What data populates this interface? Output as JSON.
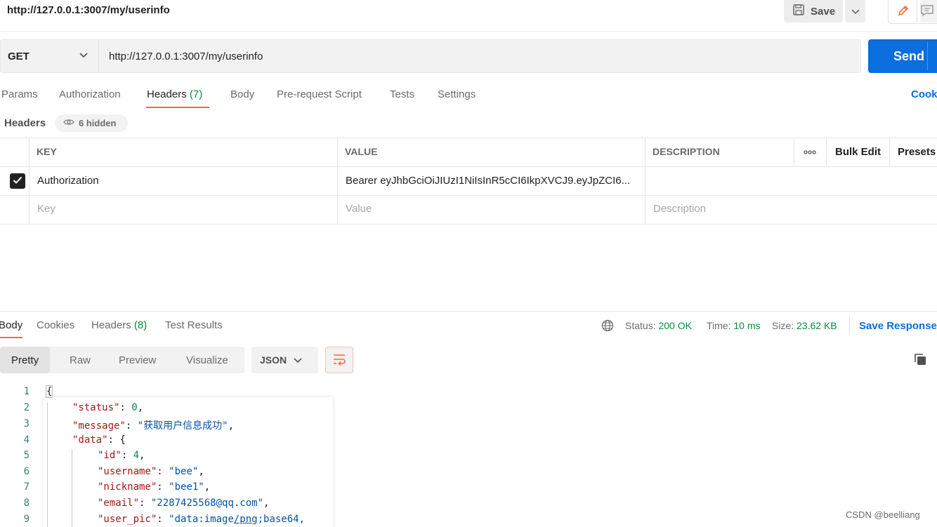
{
  "request": {
    "title": "http://127.0.0.1:3007/my/userinfo",
    "method": "GET",
    "url": "http://127.0.0.1:3007/my/userinfo",
    "save_label": "Save",
    "send_label": "Send"
  },
  "request_tabs": {
    "params": "Params",
    "authorization": "Authorization",
    "headers": "Headers",
    "headers_count": "(7)",
    "body": "Body",
    "prerequest": "Pre-request Script",
    "tests": "Tests",
    "settings": "Settings",
    "cookies": "Cook"
  },
  "headers_section": {
    "title": "Headers",
    "hidden_label": "6 hidden"
  },
  "headers_table": {
    "columns": {
      "key": "KEY",
      "value": "VALUE",
      "description": "DESCRIPTION",
      "bulk_edit": "Bulk Edit",
      "presets": "Presets"
    },
    "rows": [
      {
        "checked": true,
        "key": "Authorization",
        "value": "Bearer eyJhbGciOiJIUzI1NiIsInR5cCI6IkpXVCJ9.eyJpZCI6...",
        "description": ""
      }
    ],
    "placeholders": {
      "key": "Key",
      "value": "Value",
      "description": "Description"
    }
  },
  "response_tabs": {
    "body": "Body",
    "cookies": "Cookies",
    "headers": "Headers",
    "headers_count": "(8)",
    "test_results": "Test Results"
  },
  "response_status": {
    "status_label": "Status:",
    "status_value": "200 OK",
    "time_label": "Time:",
    "time_value": "10 ms",
    "size_label": "Size:",
    "size_value": "23.62 KB",
    "save_response": "Save Response"
  },
  "view_modes": {
    "pretty": "Pretty",
    "raw": "Raw",
    "preview": "Preview",
    "visualize": "Visualize",
    "format": "JSON"
  },
  "code_lines": {
    "l1": "{",
    "l2_key": "\"status\"",
    "l2_val": "0",
    "l3_key": "\"message\"",
    "l3_val": "\"获取用户信息成功\"",
    "l4_key": "\"data\"",
    "l4_val": "{",
    "l5_key": "\"id\"",
    "l5_val": "4",
    "l6_key": "\"username\"",
    "l6_val": "\"bee\"",
    "l7_key": "\"nickname\"",
    "l7_val": "\"bee1\"",
    "l8_key": "\"email\"",
    "l8_val": "\"2287425568@qq.com\"",
    "l9_key": "\"user_pic\"",
    "l9_val_a": "\"data:image",
    "l9_val_b": "/png",
    "l9_val_c": ";base64,"
  },
  "line_numbers": [
    "1",
    "2",
    "3",
    "4",
    "5",
    "6",
    "7",
    "8",
    "9"
  ],
  "watermark": "CSDN @beelliang",
  "colors": {
    "accent": "#f26b3a",
    "primary": "#0b6ede",
    "success": "#0c8a3d"
  }
}
